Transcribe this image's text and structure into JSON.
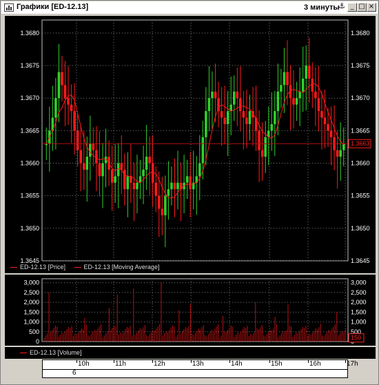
{
  "window": {
    "title": "Графики [ED-12.13]",
    "interval": "3 минуты"
  },
  "colors": {
    "up": "#2ed12a",
    "down": "#ff1a1a",
    "ma": "#ff1a1a",
    "grid": "#7a7a7a",
    "background": "#000000"
  },
  "price_panel": {
    "y_ticks": [
      "1.3680",
      "1.3675",
      "1.3670",
      "1.3665",
      "1.3660",
      "1.3655",
      "1.3650",
      "1.3645"
    ],
    "last_price_tag": "1.3663",
    "legend": {
      "price": "ED-12.13 [Price]",
      "ma": "ED-12.13 [Moving Average]"
    }
  },
  "volume_panel": {
    "y_ticks": [
      "3,000",
      "2,500",
      "2,000",
      "1,500",
      "1,000",
      "500",
      "0"
    ],
    "last_volume_tag": "150",
    "legend": "ED-12.13 [Volume]"
  },
  "time_axis": {
    "hours": [
      "10h",
      "11h",
      "12h",
      "13h",
      "14h",
      "15h",
      "16h",
      "17h"
    ],
    "day": "6"
  },
  "chart_data": [
    {
      "type": "candlestick",
      "title": "ED-12.13",
      "series": [
        {
          "name": "ED-12.13 [Price]"
        },
        {
          "name": "ED-12.13 [Moving Average]"
        }
      ],
      "ylim": [
        1.3645,
        1.3682
      ],
      "x_labels": [
        "10h",
        "11h",
        "12h",
        "13h",
        "14h",
        "15h",
        "16h",
        "17h"
      ],
      "close_path": [
        1.3663,
        1.3665,
        1.3667,
        1.367,
        1.3674,
        1.3672,
        1.367,
        1.3669,
        1.3668,
        1.3665,
        1.3662,
        1.366,
        1.3659,
        1.3661,
        1.3663,
        1.3662,
        1.366,
        1.3658,
        1.366,
        1.3661,
        1.3659,
        1.3657,
        1.3658,
        1.366,
        1.3659,
        1.3656,
        1.3658,
        1.3657,
        1.3656,
        1.3657,
        1.3658,
        1.3659,
        1.3661,
        1.366,
        1.3657,
        1.3655,
        1.3653,
        1.3652,
        1.3655,
        1.3656,
        1.3657,
        1.3656,
        1.3657,
        1.3656,
        1.3657,
        1.3658,
        1.3656,
        1.3657,
        1.3658,
        1.366,
        1.3664,
        1.3668,
        1.367,
        1.3671,
        1.367,
        1.3668,
        1.3667,
        1.3666,
        1.3668,
        1.3669,
        1.3671,
        1.367,
        1.3668,
        1.3667,
        1.3666,
        1.3668,
        1.3667,
        1.3665,
        1.3662,
        1.3661,
        1.3664,
        1.3665,
        1.3666,
        1.3668,
        1.3671,
        1.3672,
        1.3674,
        1.3672,
        1.367,
        1.3669,
        1.367,
        1.3671,
        1.3673,
        1.3675,
        1.3673,
        1.3671,
        1.367,
        1.3668,
        1.3667,
        1.3666,
        1.3665,
        1.3664,
        1.3662,
        1.3661,
        1.3662,
        1.3663
      ],
      "volume_ylim": [
        0,
        3200
      ],
      "volume_ticks": [
        0,
        500,
        1000,
        1500,
        2000,
        2500,
        3000
      ]
    }
  ]
}
